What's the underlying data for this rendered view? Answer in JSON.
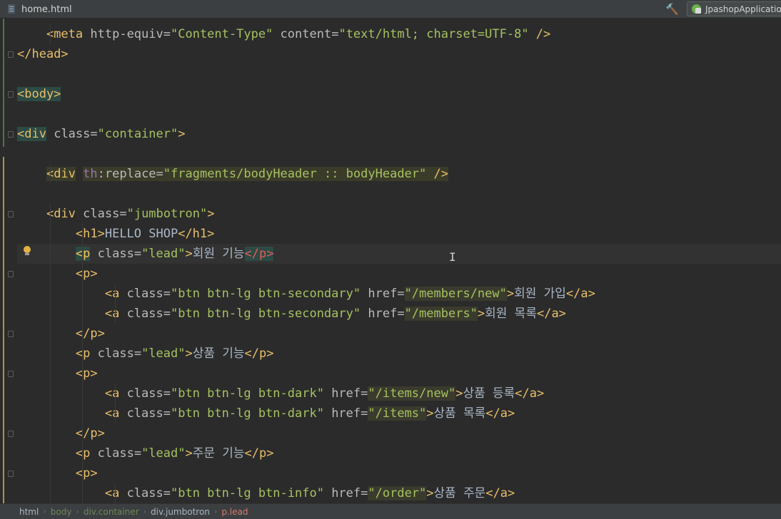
{
  "tab": {
    "title": "home.html",
    "icon": "html-file-icon"
  },
  "toolbar": {
    "build_icon": "hammer-icon",
    "run_config": "JpashopApplication"
  },
  "editor": {
    "lines": [
      [
        "    ",
        "<meta",
        " ",
        "http-equiv",
        "=",
        "\"Content-Type\"",
        " ",
        "content",
        "=",
        "\"text/html; charset=UTF-8\"",
        " />"
      ],
      [
        "</head>"
      ],
      [
        ""
      ],
      [
        "<body>"
      ],
      [
        ""
      ],
      [
        "<div",
        " ",
        "class",
        "=",
        "\"container\"",
        ">"
      ],
      [
        ""
      ],
      [
        "    ",
        "<div",
        " ",
        "th",
        ":",
        "replace",
        "=",
        "\"fragments/bodyHeader :: bodyHeader\"",
        " />"
      ],
      [
        ""
      ],
      [
        "    ",
        "<div",
        " ",
        "class",
        "=",
        "\"jumbotron\"",
        ">"
      ],
      [
        "        ",
        "<h1>",
        "HELLO SHOP",
        "</h1>"
      ],
      [
        "        ",
        "<p",
        " ",
        "class",
        "=",
        "\"lead\"",
        ">",
        "회원 기능",
        "</p>"
      ],
      [
        "        ",
        "<p>"
      ],
      [
        "            ",
        "<a",
        " ",
        "class",
        "=",
        "\"btn btn-lg btn-secondary\"",
        " ",
        "href",
        "=",
        "\"/members/new\"",
        ">",
        "회원 가입",
        "</a>"
      ],
      [
        "            ",
        "<a",
        " ",
        "class",
        "=",
        "\"btn btn-lg btn-secondary\"",
        " ",
        "href",
        "=",
        "\"/members\"",
        ">",
        "회원 목록",
        "</a>"
      ],
      [
        "        ",
        "</p>"
      ],
      [
        "        ",
        "<p",
        " ",
        "class",
        "=",
        "\"lead\"",
        ">",
        "상품 기능",
        "</p>"
      ],
      [
        "        ",
        "<p>"
      ],
      [
        "            ",
        "<a",
        " ",
        "class",
        "=",
        "\"btn btn-lg btn-dark\"",
        " ",
        "href",
        "=",
        "\"/items/new\"",
        ">",
        "상품 등록",
        "</a>"
      ],
      [
        "            ",
        "<a",
        " ",
        "class",
        "=",
        "\"btn btn-lg btn-dark\"",
        " ",
        "href",
        "=",
        "\"/items\"",
        ">",
        "상품 목록",
        "</a>"
      ],
      [
        "        ",
        "</p>"
      ],
      [
        "        ",
        "<p",
        " ",
        "class",
        "=",
        "\"lead\"",
        ">",
        "주문 기능",
        "</p>"
      ],
      [
        "        ",
        "<p>"
      ],
      [
        "            ",
        "<a",
        " ",
        "class",
        "=",
        "\"btn btn-lg btn-info\"",
        " ",
        "href",
        "=",
        "\"/order\"",
        ">",
        "상품 주문",
        "</a>"
      ]
    ]
  },
  "breadcrumbs": [
    "html",
    "body",
    "div.container",
    "div.jumbotron",
    "p.lead"
  ],
  "colors": {
    "tag": "#e8bf6a",
    "attr": "#bababa",
    "string": "#a5c261",
    "namespace": "#9876aa",
    "background": "#2b2b2b"
  }
}
